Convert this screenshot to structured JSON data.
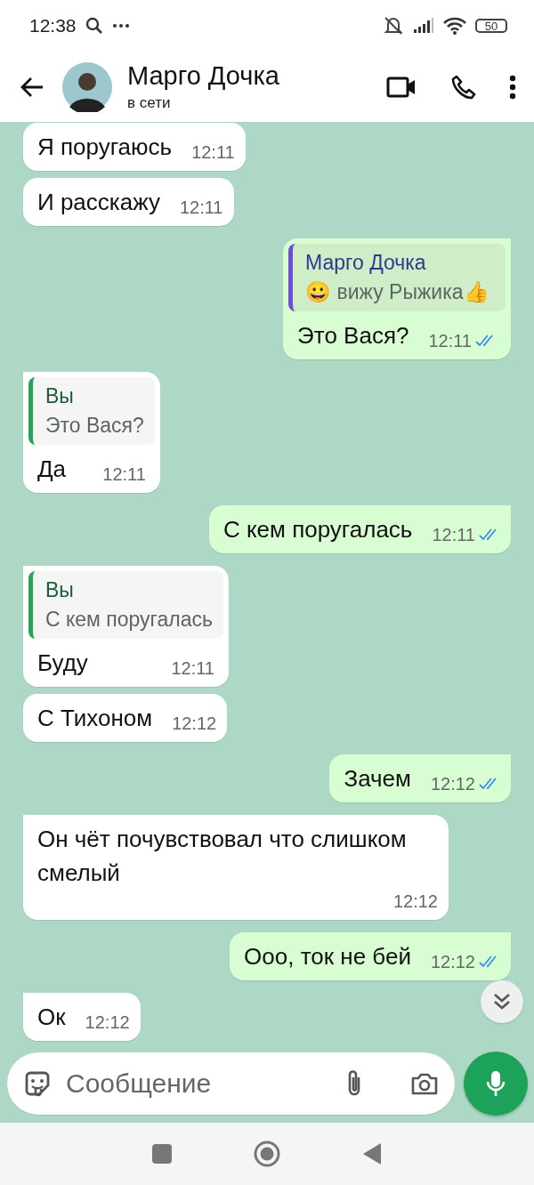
{
  "status_bar": {
    "time": "12:38",
    "battery": "50"
  },
  "header": {
    "name": "Марго Дочка",
    "status": "в сети"
  },
  "messages": [
    {
      "kind": "incoming",
      "tail": false,
      "text": "Я поругаюсь",
      "time": "12:11"
    },
    {
      "kind": "incoming",
      "tail": false,
      "text": "И расскажу",
      "time": "12:11"
    },
    {
      "kind": "outgoing",
      "tail": true,
      "quote": {
        "author": "Марго Дочка",
        "text": "😀 вижу Рыжика👍",
        "color": "#6b4fd8"
      },
      "text": "Это Вася?",
      "time": "12:11",
      "read": true
    },
    {
      "kind": "incoming",
      "tail": true,
      "quote": {
        "author": "Вы",
        "text": "Это Вася?",
        "color": "#25a35a"
      },
      "text": "Да",
      "time": "12:11"
    },
    {
      "kind": "outgoing",
      "tail": true,
      "text": "С кем поругалась",
      "time": "12:11",
      "read": true
    },
    {
      "kind": "incoming",
      "tail": true,
      "quote": {
        "author": "Вы",
        "text": "С кем поругалась",
        "color": "#25a35a"
      },
      "text": "Буду",
      "time": "12:11"
    },
    {
      "kind": "incoming",
      "tail": false,
      "text": "С Тихоном",
      "time": "12:12"
    },
    {
      "kind": "outgoing",
      "tail": true,
      "text": "Зачем",
      "time": "12:12",
      "read": true
    },
    {
      "kind": "incoming",
      "tail": true,
      "text": "Он чёт почувствовал что слишком смелый",
      "time": "12:12"
    },
    {
      "kind": "outgoing",
      "tail": true,
      "text": "Ооо, ток не бей",
      "time": "12:12",
      "read": true
    },
    {
      "kind": "incoming",
      "tail": true,
      "text": "Ок",
      "time": "12:12"
    }
  ],
  "composer": {
    "placeholder": "Сообщение"
  }
}
